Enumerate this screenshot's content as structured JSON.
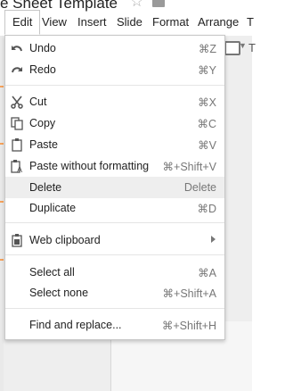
{
  "document": {
    "title_fragment": "e Sheet Template",
    "star_icon": "star-outline-icon",
    "folder_icon": "folder-icon"
  },
  "menubar": {
    "items": [
      {
        "label": "Edit",
        "active": true
      },
      {
        "label": "View"
      },
      {
        "label": "Insert"
      },
      {
        "label": "Slide"
      },
      {
        "label": "Format"
      },
      {
        "label": "Arrange"
      },
      {
        "label": "T"
      }
    ]
  },
  "edit_menu": {
    "undo": {
      "label": "Undo",
      "shortcut": "⌘Z",
      "icon": "undo-icon"
    },
    "redo": {
      "label": "Redo",
      "shortcut": "⌘Y",
      "icon": "redo-icon"
    },
    "cut": {
      "label": "Cut",
      "shortcut": "⌘X",
      "icon": "scissors-icon"
    },
    "copy": {
      "label": "Copy",
      "shortcut": "⌘C",
      "icon": "copy-icon"
    },
    "paste": {
      "label": "Paste",
      "shortcut": "⌘V",
      "icon": "clipboard-icon"
    },
    "paste_plain": {
      "label": "Paste without formatting",
      "shortcut": "⌘+Shift+V",
      "icon": "paste-plain-text-icon"
    },
    "delete": {
      "label": "Delete",
      "shortcut": "Delete",
      "highlighted": true
    },
    "duplicate": {
      "label": "Duplicate",
      "shortcut": "⌘D"
    },
    "web_clipboard": {
      "label": "Web clipboard",
      "icon": "web-clipboard-icon",
      "has_submenu": true
    },
    "select_all": {
      "label": "Select all",
      "shortcut": "⌘A"
    },
    "select_none": {
      "label": "Select none",
      "shortcut": "⌘+Shift+A"
    },
    "find_replace": {
      "label": "Find and replace...",
      "shortcut": "⌘+Shift+H"
    }
  },
  "colors": {
    "menu_bg": "#ffffff",
    "hover_bg": "#eeeeee",
    "border": "#c6c6c6",
    "shortcut_text": "#777777",
    "app_bg": "#eeeeee",
    "thumbnail_accent": "#f5a25b"
  }
}
